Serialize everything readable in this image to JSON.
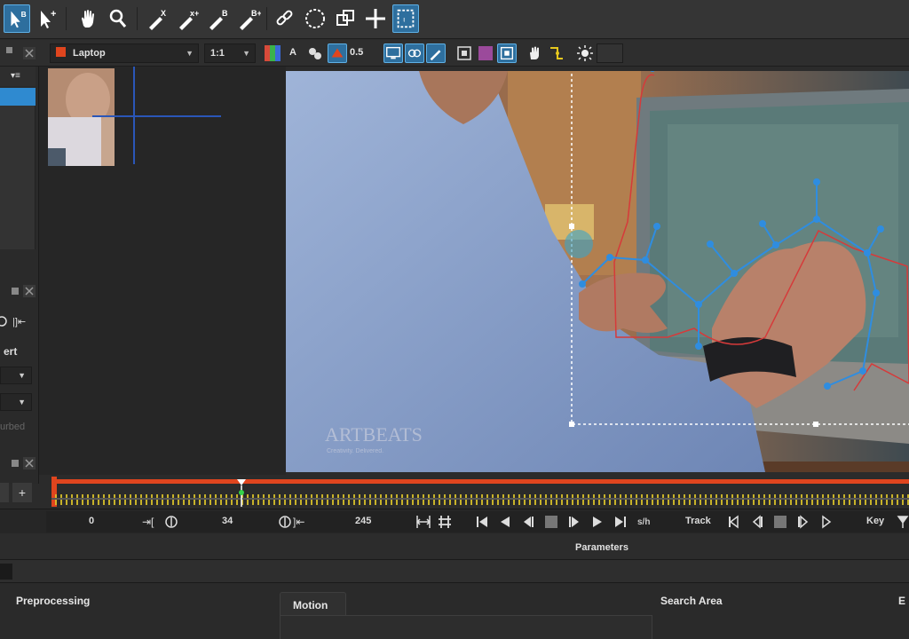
{
  "toolbar2": {
    "layer_name": "Laptop",
    "layer_color": "#e0451e",
    "zoom": "1:1",
    "channel_label": "A",
    "opacity_value": "0.5"
  },
  "left_panel": {
    "partial_label": "ert",
    "partial_label_2": "urbed"
  },
  "viewer": {
    "watermark": "ARTBEATS",
    "watermark_sub": "Creativity. Delivered."
  },
  "timeline": {
    "accent_color": "#e0451e",
    "current_frame_ratio": 0.086
  },
  "transport": {
    "start_frame": "0",
    "current_frame": "34",
    "end_frame": "245",
    "track_label": "Track",
    "key_label": "Key",
    "fps_label": "s/h"
  },
  "parameters": {
    "title": "Parameters",
    "sections": {
      "preprocessing": "Preprocessing",
      "motion": "Motion",
      "search_area": "Search Area",
      "e_partial": "E"
    }
  },
  "colors": {
    "accent_blue": "#2e6f9e",
    "spline_red": "#d63a3a",
    "point_blue": "#2f8de0"
  }
}
